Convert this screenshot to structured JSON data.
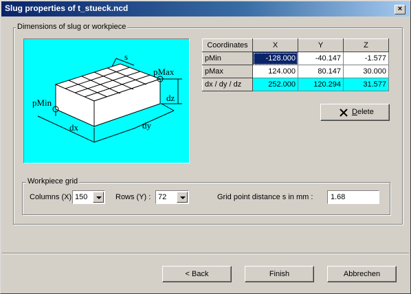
{
  "window": {
    "title": "Slug properties of t_stueck.ncd",
    "close_glyph": "×"
  },
  "dimensions_group": {
    "label": "Dimensions of slug or workpiece"
  },
  "diagram": {
    "labels": {
      "s": "s",
      "pMax": "pMax",
      "pMin": "pMin",
      "dz": "dz",
      "dx": "dx",
      "dy": "dy"
    }
  },
  "coords_table": {
    "headers": [
      "Coordinates",
      "X",
      "Y",
      "Z"
    ],
    "rows": [
      {
        "label": "pMin",
        "x": "-128.000",
        "y": "-40.147",
        "z": "-1.577"
      },
      {
        "label": "pMax",
        "x": "124.000",
        "y": "80.147",
        "z": "30.000"
      },
      {
        "label": "dx / dy / dz",
        "x": "252.000",
        "y": "120.294",
        "z": "31.577"
      }
    ]
  },
  "delete_button": {
    "icon": "x-icon",
    "label_u": "D",
    "label_rest": "elete"
  },
  "grid_group": {
    "label": "Workpiece grid",
    "columns_label": "Columns (X) :",
    "columns_value": "150",
    "rows_label": "Rows (Y) :",
    "rows_value": "72",
    "distance_label": "Grid point distance s in mm :",
    "distance_value": "1.68"
  },
  "footer": {
    "back": "< Back",
    "finish": "Finish",
    "cancel": "Abbrechen"
  },
  "colors": {
    "accent": "#0a246a",
    "diagram_bg": "#00ffff",
    "face": "#d4d0c8"
  }
}
